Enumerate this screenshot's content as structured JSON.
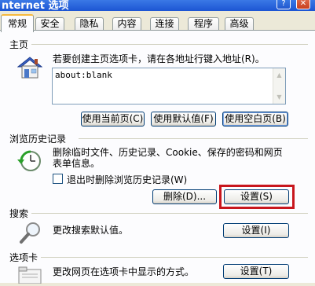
{
  "window": {
    "title": "nternet 选项",
    "help_glyph": "?",
    "close_glyph": "✕"
  },
  "tabs": [
    {
      "label": "常规",
      "active": true
    },
    {
      "label": "安全"
    },
    {
      "label": "隐私"
    },
    {
      "label": "内容"
    },
    {
      "label": "连接"
    },
    {
      "label": "程序"
    },
    {
      "label": "高级"
    }
  ],
  "homepage": {
    "section_label": "主页",
    "description": "若要创建主页选项卡，请在各地址行键入地址(R)。",
    "address_value": "about:blank",
    "buttons": {
      "use_current": "使用当前页(C)",
      "use_default": "使用默认值(F)",
      "use_blank": "使用空白页(B)"
    }
  },
  "history": {
    "section_label": "浏览历史记录",
    "description_line1": "删除临时文件、历史记录、Cookie、保存的密码和网页",
    "description_line2": "表单信息。",
    "checkbox_label": "退出时删除浏览历史记录(W)",
    "checkbox_checked": false,
    "delete_button": "删除(D)...",
    "settings_button": "设置(S)"
  },
  "search": {
    "section_label": "搜索",
    "description": "更改搜索默认值。",
    "settings_button": "设置(I)"
  },
  "tabs_section": {
    "section_label": "选项卡",
    "description": "更改网页在选项卡中显示的方式。",
    "settings_button": "设置(T)"
  },
  "highlight_color": "#c8161d"
}
